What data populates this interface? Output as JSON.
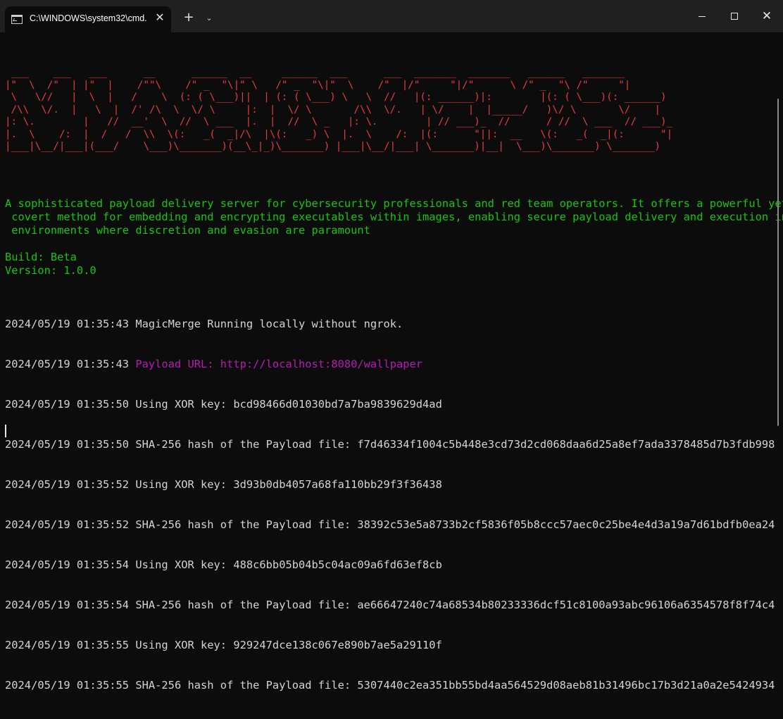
{
  "titlebar": {
    "tab_title": "C:\\WINDOWS\\system32\\cmd.",
    "tab_close": "✕",
    "new_tab": "+",
    "dropdown": "⌄",
    "close": "✕"
  },
  "terminal": {
    "banner": " ___    ___   ___      __      ______  __     ______  ___      ___  _______  _______   ______   _______\n|\"  \\  /\"  | |\"  |    /\"\"\\    /\" _  \"\\|\" \\   /\" _  \"\\|\"  \\    /\"  |/\"     \"|/\"      \\ /\" _  \"\\ /\"     \"|\n \\   \\//   |  \\  |   /    \\  (: ( \\___)||  | (: ( \\___) \\   \\  //   |(: ______)|:        |(: ( \\___)(: ______)\n /\\\\  \\/.  |   \\  |  /' /\\  \\  \\/ \\     |:  |  \\/ \\       /\\\\  \\/.   | \\/    |  |_____/   )\\/ \\       \\/    |\n|: \\.        |   //  __'  \\  //  \\ ___  |.  |  //  \\ _   |: \\.        | // ___)_  //      / //  \\ ___  // ___)_\n|.  \\    /:  |  /   /  \\\\  \\(:   _(  _|/\\  |\\(:   _) \\  |.  \\    /:  |(:      \"||:  __   \\(:   _(  _|(:      \"|\n|___|\\__/|___|(___/    \\___)\\_______)(__\\_|_)\\_______) |___|\\__/|___| \\_______)|__|  \\___)\\_______) \\_______)",
    "description": "A sophisticated payload delivery server for cybersecurity professionals and red team operators. It offers a powerful yet\n covert method for embedding and encrypting executables within images, enabling secure payload delivery and execution in\n environments where discretion and evasion are paramount",
    "build": "Build: Beta",
    "version": "Version: 1.0.0",
    "log": [
      {
        "ts": "2024/05/19 01:35:43",
        "msg": "MagicMerge Running locally without ngrok."
      },
      {
        "ts": "2024/05/19 01:35:43",
        "msg": "Payload URL: http://localhost:8080/wallpaper"
      },
      {
        "ts": "2024/05/19 01:35:50",
        "msg": "Using XOR key: bcd98466d01030bd7a7ba9839629d4ad"
      },
      {
        "ts": "2024/05/19 01:35:50",
        "msg": "SHA-256 hash of the Payload file: f7d46334f1004c5b448e3cd73d2cd068daa6d25a8ef7ada3378485d7b3fdb998"
      },
      {
        "ts": "2024/05/19 01:35:52",
        "msg": "Using XOR key: 3d93b0db4057a68fa110bb29f3f36438"
      },
      {
        "ts": "2024/05/19 01:35:52",
        "msg": "SHA-256 hash of the Payload file: 38392c53e5a8733b2cf5836f05b8ccc57aec0c25be4e4d3a19a7d61bdfb0ea24"
      },
      {
        "ts": "2024/05/19 01:35:54",
        "msg": "Using XOR key: 488c6bb05b04b5c04ac09a6fd63ef8cb"
      },
      {
        "ts": "2024/05/19 01:35:54",
        "msg": "SHA-256 hash of the Payload file: ae66647240c74a68534b80233336dcf51c8100a93abc96106a6354578f8f74c4"
      },
      {
        "ts": "2024/05/19 01:35:55",
        "msg": "Using XOR key: 929247dce138c067e890b7ae5a29110f"
      },
      {
        "ts": "2024/05/19 01:35:55",
        "msg": "SHA-256 hash of the Payload file: 5307440c2ea351bb55bd4aa564529d08aeb81b31496bc17b3d21a0a2e5424934"
      }
    ]
  },
  "colors": {
    "banner": "#e83c3c",
    "info": "#16c60c",
    "log": "#d4d4d4",
    "url": "#b41cb4"
  }
}
